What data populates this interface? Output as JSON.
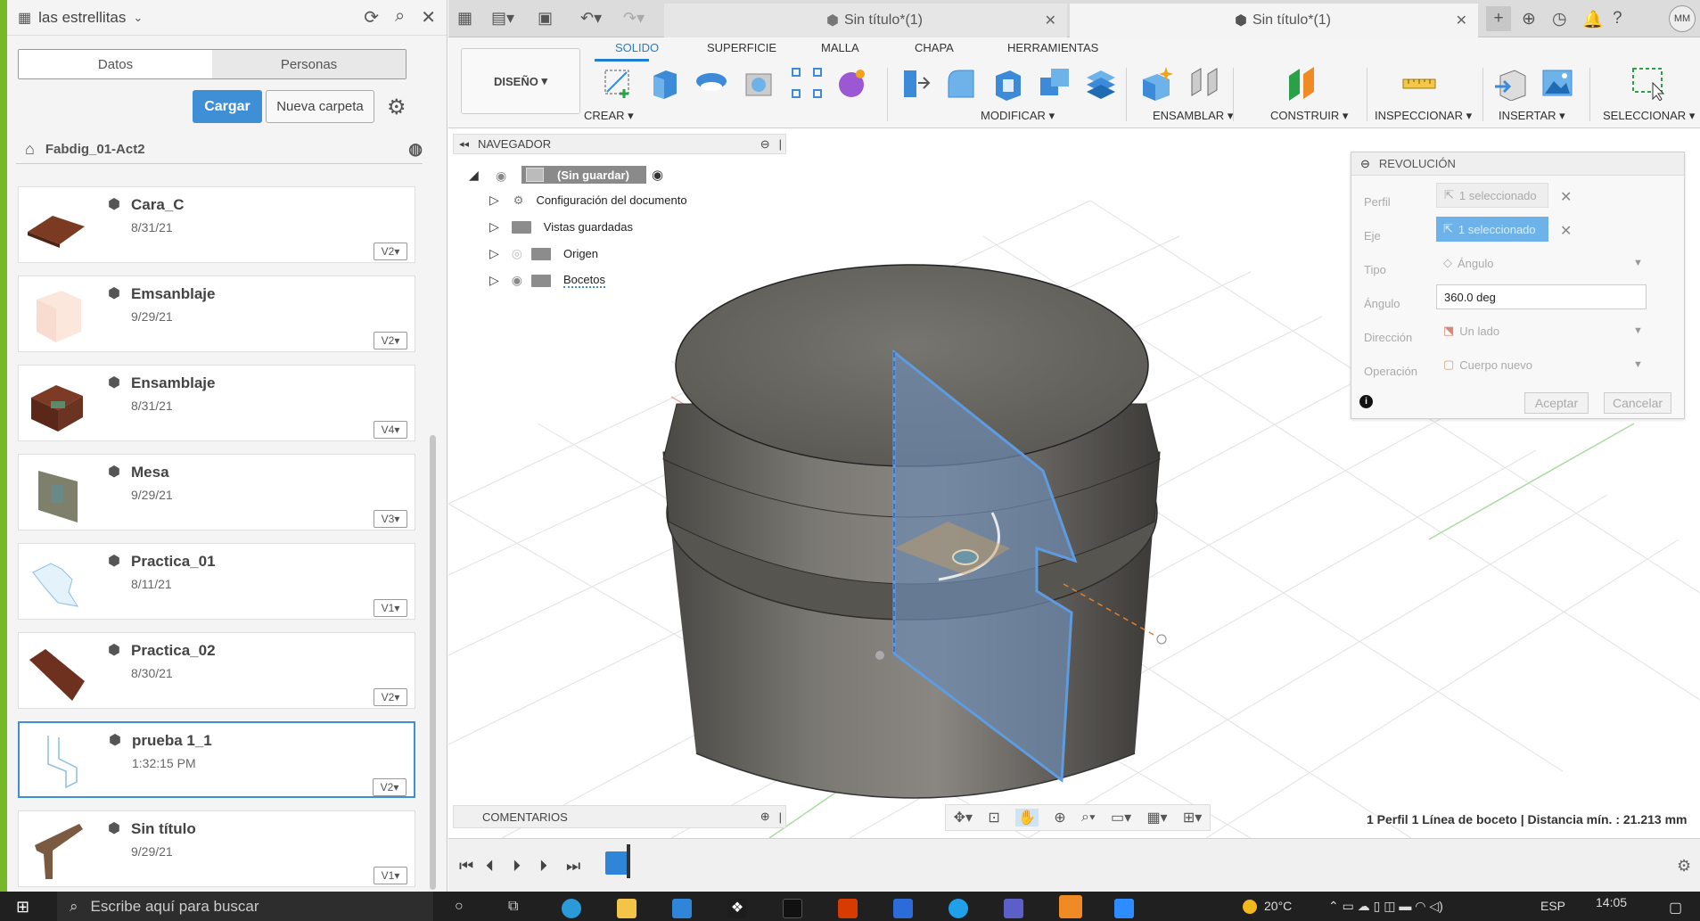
{
  "left_panel": {
    "project_title": "las estrellitas",
    "tabs": [
      "Datos",
      "Personas"
    ],
    "upload_label": "Cargar",
    "new_folder_label": "Nueva carpeta",
    "breadcrumb": "Fabdig_01-Act2",
    "files": [
      {
        "name": "Cara_C",
        "date": "8/31/21",
        "version": "V2",
        "thumb": "#7a3b22"
      },
      {
        "name": "Emsanblaje",
        "date": "9/29/21",
        "version": "V2",
        "thumb": "#fbe7dc"
      },
      {
        "name": "Ensamblaje",
        "date": "8/31/21",
        "version": "V4",
        "thumb": "#6a3322"
      },
      {
        "name": "Mesa",
        "date": "9/29/21",
        "version": "V3",
        "thumb": "#7f806b"
      },
      {
        "name": "Practica_01",
        "date": "8/11/21",
        "version": "V1",
        "thumb": "#cfe6f6"
      },
      {
        "name": "Practica_02",
        "date": "8/30/21",
        "version": "V2",
        "thumb": "#6e3120"
      },
      {
        "name": "prueba 1_1",
        "date": "1:32:15 PM",
        "version": "V2",
        "thumb": "#dfeef8"
      },
      {
        "name": "Sin título",
        "date": "9/29/21",
        "version": "V1",
        "thumb": "#7a5a40"
      }
    ]
  },
  "tabs": {
    "tab1": "Sin título*(1)",
    "tab2": "Sin título*(1)"
  },
  "user_initials": "MM",
  "ribbon": {
    "workspace": "DISEÑO",
    "tabs": [
      "SOLIDO",
      "SUPERFICIE",
      "MALLA",
      "CHAPA",
      "HERRAMIENTAS"
    ],
    "active_tab": "SOLIDO",
    "groups": [
      "CREAR",
      "MODIFICAR",
      "ENSAMBLAR",
      "CONSTRUIR",
      "INSPECCIONAR",
      "INSERTAR",
      "SELECCIONAR"
    ]
  },
  "navigator": {
    "title": "NAVEGADOR",
    "root": "(Sin guardar)",
    "items": [
      "Configuración del documento",
      "Vistas guardadas",
      "Origen",
      "Bocetos"
    ]
  },
  "revolve": {
    "title": "REVOLUCIÓN",
    "rows": [
      {
        "label": "Perfil",
        "value": "1 seleccionado"
      },
      {
        "label": "Eje",
        "value": "1 seleccionado"
      },
      {
        "label": "Tipo",
        "value": "Ángulo"
      },
      {
        "label": "Ángulo",
        "value": "360.0 deg"
      },
      {
        "label": "Dirección",
        "value": "Un lado"
      },
      {
        "label": "Operación",
        "value": "Cuerpo nuevo"
      }
    ],
    "ok": "Aceptar",
    "cancel": "Cancelar"
  },
  "comments_label": "COMENTARIOS",
  "status_text": "1 Perfil 1 Línea de boceto | Distancia mín. : 21.213 mm",
  "taskbar": {
    "search_placeholder": "Escribe aquí para buscar",
    "weather": "20°C",
    "language": "ESP",
    "time": "14:05"
  },
  "colors": {
    "accent": "#1f7ed0",
    "upload_button": "#3f8fd6",
    "selection_blue": "#6db3ea",
    "model_gray": "#6b6966"
  }
}
